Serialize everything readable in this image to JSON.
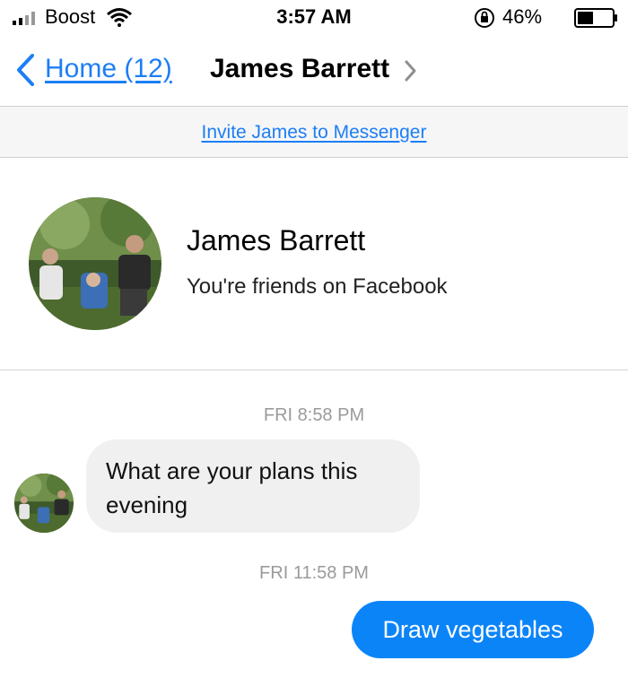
{
  "status_bar": {
    "carrier": "Boost",
    "time": "3:57 AM",
    "battery_percent": "46%",
    "battery_level": 0.46
  },
  "nav": {
    "back_label": "Home (12)",
    "title": "James Barrett"
  },
  "invite": {
    "label": "Invite James to Messenger"
  },
  "profile": {
    "name": "James Barrett",
    "subtitle": "You're friends on Facebook"
  },
  "messages": [
    {
      "timestamp": "FRI 8:58 PM",
      "direction": "incoming",
      "text": "What are your plans this evening"
    },
    {
      "timestamp": "FRI 11:58 PM",
      "direction": "outgoing",
      "text": "Draw vegetables"
    }
  ],
  "colors": {
    "accent": "#1d7ef5",
    "outgoing_bubble": "#0b84f8",
    "incoming_bubble": "#f0f0f1",
    "timestamp": "#9a9a9a"
  },
  "icons": {
    "signal": "signal-icon",
    "wifi": "wifi-icon",
    "lock": "rotation-lock-icon",
    "battery": "battery-icon",
    "back": "chevron-left-icon",
    "title_chevron": "chevron-right-icon"
  }
}
